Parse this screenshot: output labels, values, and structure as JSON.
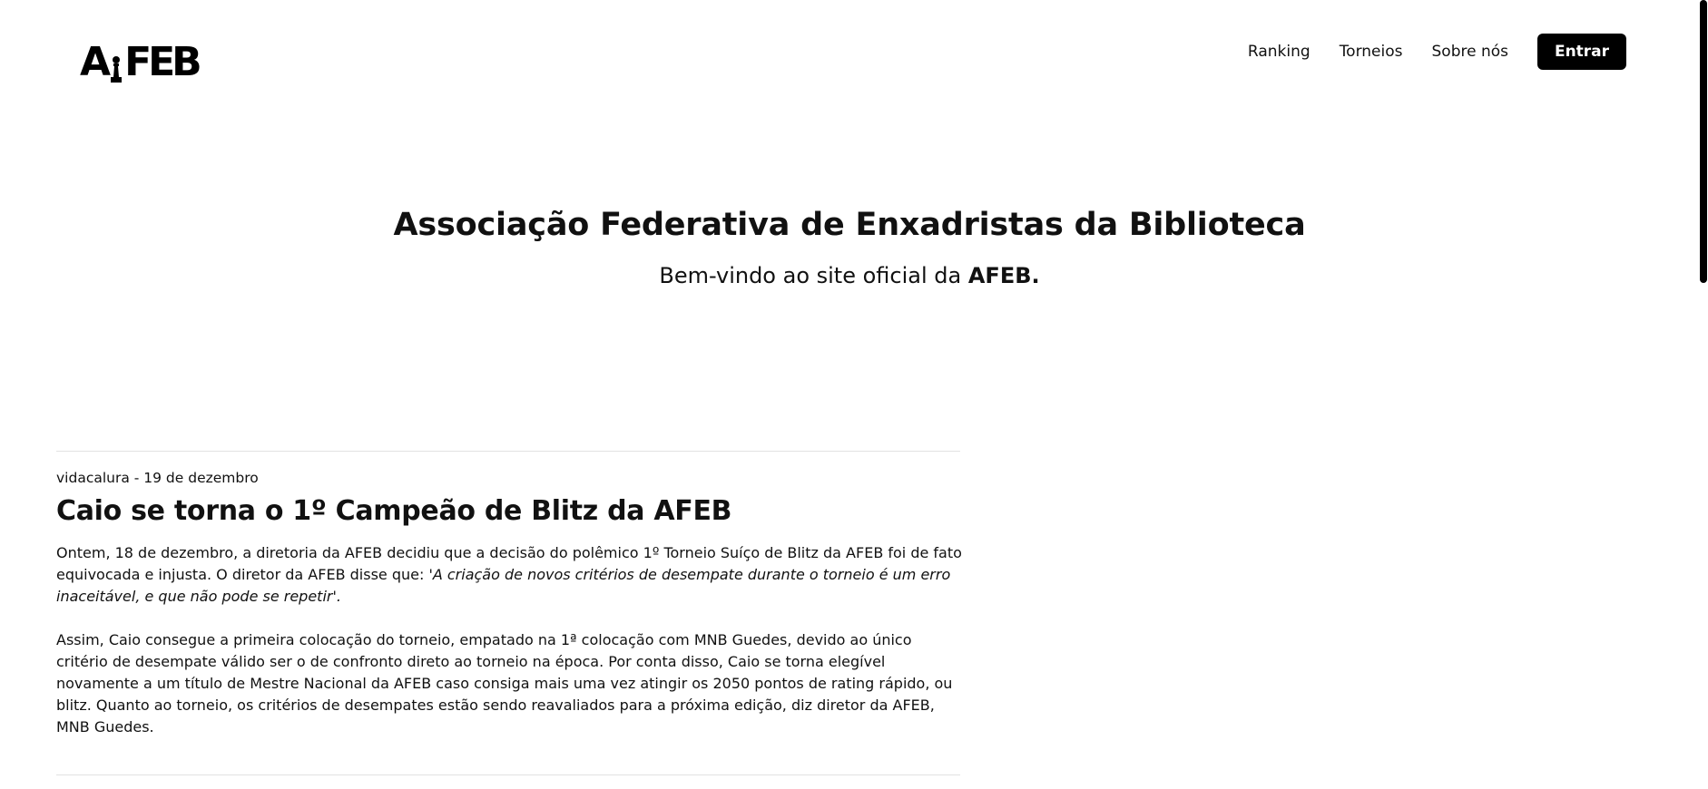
{
  "header": {
    "logo_text_a": "A",
    "logo_text_rest": "FEB",
    "logo_icon": "chess-pawn-icon",
    "nav": [
      "Ranking",
      "Torneios",
      "Sobre nós"
    ],
    "login_label": "Entrar"
  },
  "hero": {
    "title": "Associação Federativa de Enxadristas da Biblioteca",
    "subtitle_prefix": "Bem-vindo ao site oficial da ",
    "subtitle_bold": "AFEB."
  },
  "post": {
    "meta": "vidacalura - 19 de dezembro",
    "title": "Caio se torna o 1º Campeão de Blitz da AFEB",
    "p1_text": "Ontem, 18 de dezembro, a diretoria da AFEB decidiu que a decisão do polêmico 1º Torneio Suíço de Blitz da AFEB foi de fato equivocada e injusta. O diretor da AFEB disse que: ",
    "p1_quote": "'A criação de novos critérios de desempate durante o torneio é um erro inaceitável, e que não pode se repetir'.",
    "p2_text": "Assim, Caio consegue a primeira colocação do torneio, empatado na 1ª colocação com MNB Guedes, devido ao único critério de desempate válido ser o de confronto direto ao torneio na época. Por conta disso, Caio se torna elegível novamente a um título de Mestre Nacional da AFEB caso consiga mais uma vez atingir os 2050 pontos de rating rápido, ou blitz. Quanto ao torneio, os critérios de desempates estão sendo reavaliados para a próxima edição, diz diretor da AFEB, MNB Guedes."
  }
}
